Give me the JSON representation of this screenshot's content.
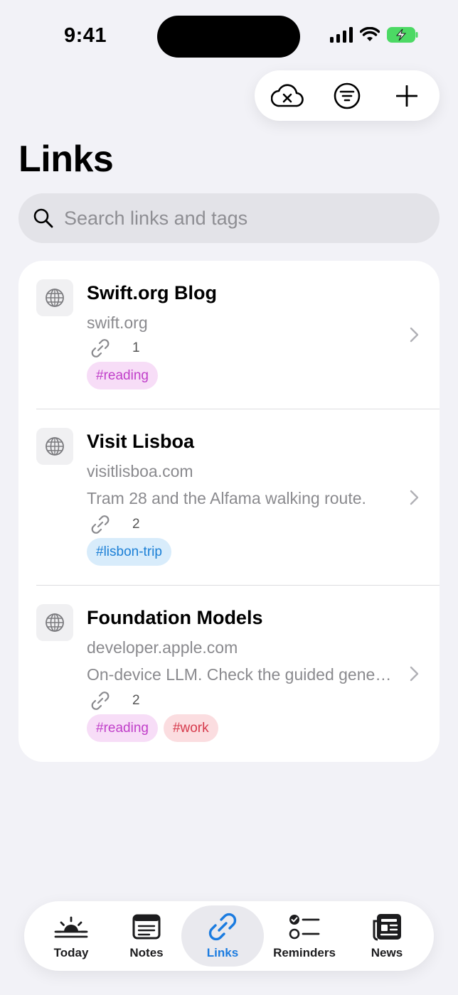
{
  "status_bar": {
    "time": "9:41"
  },
  "toolbar": {
    "buttons": [
      "cloud-x-icon",
      "filter-icon",
      "plus-icon"
    ]
  },
  "page": {
    "title": "Links"
  },
  "search": {
    "placeholder": "Search links and tags",
    "value": ""
  },
  "links": [
    {
      "title": "Swift.org Blog",
      "domain": "swift.org",
      "note": "",
      "link_count": "1",
      "tags": [
        {
          "label": "#reading",
          "color": "#c03fc9",
          "bg": "#f7ddf7"
        }
      ]
    },
    {
      "title": "Visit Lisboa",
      "domain": "visitlisboa.com",
      "note": "Tram 28 and the Alfama walking route.",
      "link_count": "2",
      "tags": [
        {
          "label": "#lisbon-trip",
          "color": "#1b7fd6",
          "bg": "#d8ecfb"
        }
      ]
    },
    {
      "title": "Foundation Models",
      "domain": "developer.apple.com",
      "note": "On-device LLM. Check the guided generation API.",
      "link_count": "2",
      "tags": [
        {
          "label": "#reading",
          "color": "#c03fc9",
          "bg": "#f7ddf7"
        },
        {
          "label": "#work",
          "color": "#d63a4c",
          "bg": "#fbdde0"
        }
      ]
    }
  ],
  "tab_bar": {
    "active": "Links",
    "accent": "#1a7be0",
    "tabs": [
      {
        "label": "Today",
        "icon": "sunrise-icon"
      },
      {
        "label": "Notes",
        "icon": "notes-icon"
      },
      {
        "label": "Links",
        "icon": "link-icon"
      },
      {
        "label": "Reminders",
        "icon": "checklist-icon"
      },
      {
        "label": "News",
        "icon": "newspaper-icon"
      }
    ]
  }
}
